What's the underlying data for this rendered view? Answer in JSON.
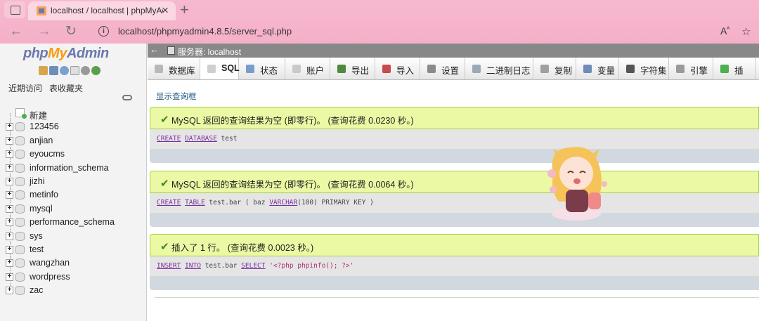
{
  "browser": {
    "tab_title": "localhost / localhost | phpMyAdmin",
    "url": "localhost/phpmyadmin4.8.5/server_sql.php",
    "reader_icon": "read-aloud-icon",
    "fav_icon": "favorites-icon"
  },
  "sidebar": {
    "logo_php": "php",
    "logo_my": "My",
    "logo_admin": "Admin",
    "tab_recent": "近期访问",
    "tab_favorites": "表收藏夹",
    "new_label": "新建",
    "databases": [
      "123456",
      "anjian",
      "eyoucms",
      "information_schema",
      "jizhi",
      "metinfo",
      "mysql",
      "performance_schema",
      "sys",
      "test",
      "wangzhan",
      "wordpress",
      "zac"
    ]
  },
  "main": {
    "server_label": "服务器: localhost",
    "menu": [
      {
        "label": "数据库",
        "icon": "database-icon",
        "color": "#b8b8b8"
      },
      {
        "label": "SQL",
        "icon": "sql-icon",
        "color": "#cfcfcf"
      },
      {
        "label": "状态",
        "icon": "status-icon",
        "color": "#7a9cc8"
      },
      {
        "label": "账户",
        "icon": "accounts-icon",
        "color": "#c9c9c9"
      },
      {
        "label": "导出",
        "icon": "export-icon",
        "color": "#4d8a3e"
      },
      {
        "label": "导入",
        "icon": "import-icon",
        "color": "#c84a4a"
      },
      {
        "label": "设置",
        "icon": "settings-icon",
        "color": "#8a8a8a"
      },
      {
        "label": "二进制日志",
        "icon": "binlog-icon",
        "color": "#9aa9b8"
      },
      {
        "label": "复制",
        "icon": "replication-icon",
        "color": "#a0a0a0"
      },
      {
        "label": "变量",
        "icon": "variables-icon",
        "color": "#6f8cb8"
      },
      {
        "label": "字符集",
        "icon": "charset-icon",
        "color": "#555555"
      },
      {
        "label": "引擎",
        "icon": "engines-icon",
        "color": "#9a9a9a"
      },
      {
        "label": "插",
        "icon": "plugins-icon",
        "color": "#4caf50"
      }
    ],
    "show_query": "显示查询框",
    "results": [
      {
        "message": "MySQL 返回的查询结果为空 (即零行)。 (查询花费 0.0230 秒。)",
        "sql_parts": [
          {
            "t": "CREATE",
            "k": "kw"
          },
          {
            "t": " "
          },
          {
            "t": "DATABASE",
            "k": "kw"
          },
          {
            "t": " test"
          }
        ]
      },
      {
        "message": "MySQL 返回的查询结果为空 (即零行)。 (查询花费 0.0064 秒。)",
        "sql_parts": [
          {
            "t": "CREATE",
            "k": "kw"
          },
          {
            "t": " "
          },
          {
            "t": "TABLE",
            "k": "kw"
          },
          {
            "t": " test.bar ( baz "
          },
          {
            "t": "VARCHAR",
            "k": "kw"
          },
          {
            "t": "(100) PRIMARY KEY )"
          }
        ]
      },
      {
        "message": "插入了 1 行。 (查询花费 0.0023 秒。)",
        "sql_parts": [
          {
            "t": "INSERT",
            "k": "kw"
          },
          {
            "t": " "
          },
          {
            "t": "INTO",
            "k": "kw"
          },
          {
            "t": " test.bar "
          },
          {
            "t": "SELECT",
            "k": "kw"
          },
          {
            "t": " "
          },
          {
            "t": "'<?php phpinfo(); ?>'",
            "k": "str"
          }
        ]
      }
    ]
  }
}
